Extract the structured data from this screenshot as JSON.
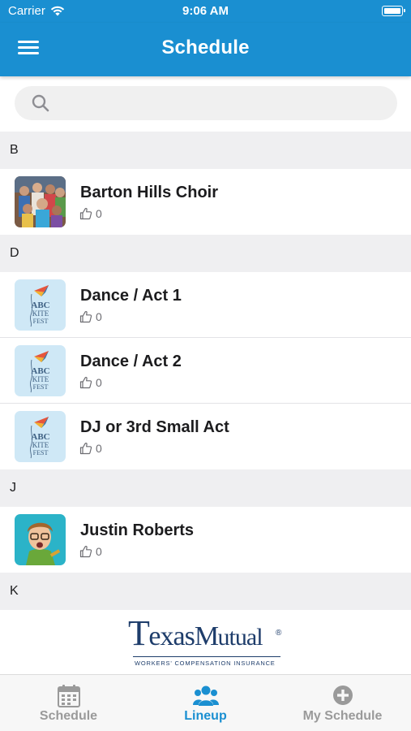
{
  "status_bar": {
    "carrier": "Carrier",
    "time": "9:06 AM"
  },
  "header": {
    "title": "Schedule",
    "menu_icon": "hamburger-menu-icon"
  },
  "search": {
    "placeholder": "",
    "icon": "search-icon"
  },
  "sections": [
    {
      "letter": "B",
      "items": [
        {
          "title": "Barton Hills Choir",
          "likes": "0",
          "thumb": "choir-photo"
        }
      ]
    },
    {
      "letter": "D",
      "items": [
        {
          "title": "Dance / Act 1",
          "likes": "0",
          "thumb": "abc-kite-fest-logo"
        },
        {
          "title": "Dance / Act 2",
          "likes": "0",
          "thumb": "abc-kite-fest-logo"
        },
        {
          "title": "DJ or 3rd Small Act",
          "likes": "0",
          "thumb": "abc-kite-fest-logo"
        }
      ]
    },
    {
      "letter": "J",
      "items": [
        {
          "title": "Justin Roberts",
          "likes": "0",
          "thumb": "performer-photo"
        }
      ]
    },
    {
      "letter": "K",
      "items": []
    }
  ],
  "sponsor": {
    "name_big_1": "T",
    "name_small_1": "exas",
    "name_big_2": "M",
    "name_small_2": "utual",
    "registered": "®",
    "tagline": "WORKERS' COMPENSATION INSURANCE"
  },
  "logo_text": {
    "line1": "ABC",
    "line2": "KITE",
    "line3": "FEST"
  },
  "tabs": [
    {
      "label": "Schedule",
      "icon": "calendar-icon",
      "active": false
    },
    {
      "label": "Lineup",
      "icon": "group-icon",
      "active": true
    },
    {
      "label": "My Schedule",
      "icon": "plus-circle-icon",
      "active": false
    }
  ],
  "colors": {
    "accent": "#1a8fd1",
    "tab_inactive": "#9a9a9a",
    "section_bg": "#efeff1",
    "sponsor_navy": "#1e3d6b"
  }
}
